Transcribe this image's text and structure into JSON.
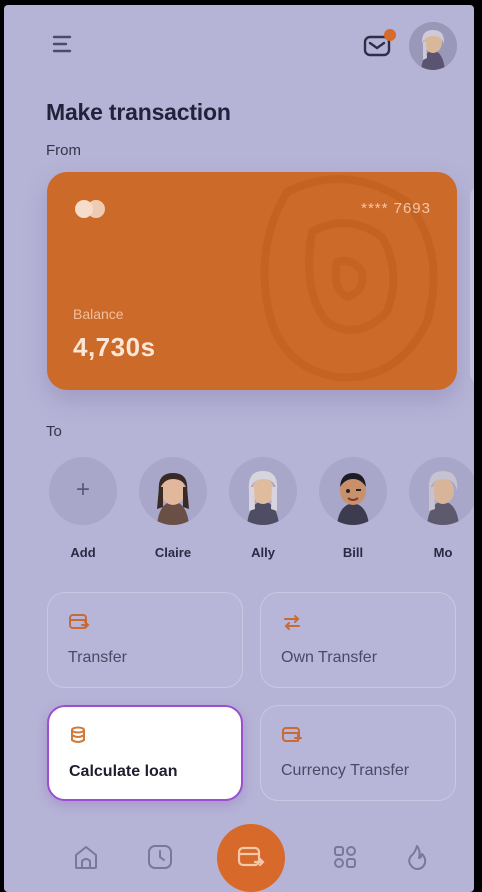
{
  "header": {
    "menu_icon": "hamburger-menu-icon",
    "notification_icon": "mail-notification-icon",
    "notification_dot_color": "#d56b2c",
    "avatar": "user-avatar"
  },
  "page": {
    "title": "Make transaction",
    "from_label": "From",
    "to_label": "To"
  },
  "card": {
    "number_masked": "**** 7693",
    "balance_label": "Balance",
    "balance_value": "4,730s",
    "color": "#cc6a2a",
    "logo_icon": "card-brand-logo"
  },
  "contacts": [
    {
      "name": "Add",
      "icon": "plus-icon"
    },
    {
      "name": "Claire"
    },
    {
      "name": "Ally"
    },
    {
      "name": "Bill"
    },
    {
      "name": "Mo"
    }
  ],
  "actions": [
    {
      "label": "Transfer",
      "icon": "transfer-icon"
    },
    {
      "label": "Own Transfer",
      "icon": "swap-arrows-icon"
    },
    {
      "label": "Calculate loan",
      "icon": "coins-icon",
      "selected": true
    },
    {
      "label": "Currency Transfer",
      "icon": "currency-transfer-icon"
    }
  ],
  "nav": [
    {
      "icon": "home-icon"
    },
    {
      "icon": "history-icon"
    },
    {
      "icon": "transfer-icon",
      "active": true
    },
    {
      "icon": "apps-grid-icon"
    },
    {
      "icon": "fire-icon"
    }
  ],
  "colors": {
    "accent": "#d7692b",
    "selection_border": "#9a4fd0",
    "background": "#b6b4d6"
  }
}
